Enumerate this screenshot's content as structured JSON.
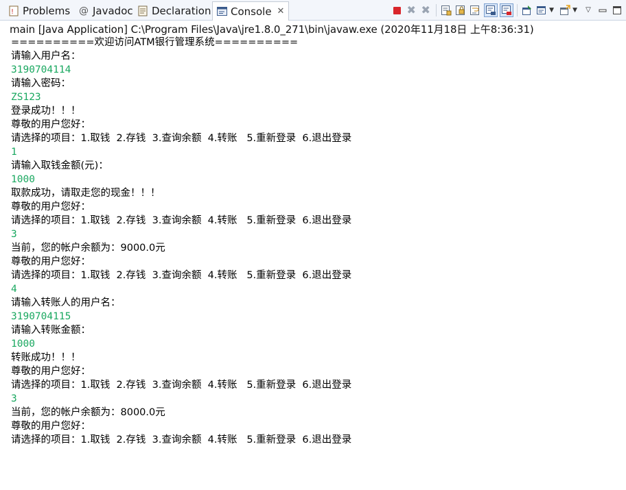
{
  "tabs": [
    {
      "label": "Problems",
      "icon": "problems-icon",
      "active": false
    },
    {
      "label": "Javadoc",
      "icon": "javadoc-icon",
      "active": false
    },
    {
      "label": "Declaration",
      "icon": "declaration-icon",
      "active": false
    },
    {
      "label": "Console",
      "icon": "console-icon",
      "active": true
    }
  ],
  "toolbar_icons": [
    "terminate-icon",
    "remove-launch-icon",
    "remove-all-terminated-icon",
    "clear-console-icon",
    "scroll-lock-icon",
    "word-wrap-icon",
    "show-console-on-stdout-icon",
    "show-console-on-stderr-icon",
    "pin-console-icon",
    "display-selected-console-icon",
    "open-console-icon",
    "view-menu-icon",
    "minimize-icon",
    "maximize-icon"
  ],
  "header": "main [Java Application] C:\\Program Files\\Java\\jre1.8.0_271\\bin\\javaw.exe (2020年11月18日 上午8:36:31)",
  "console_lines": [
    {
      "text": "==========欢迎访问ATM银行管理系统==========",
      "type": "out"
    },
    {
      "text": "请输入用户名：",
      "type": "out"
    },
    {
      "text": "3190704114",
      "type": "in"
    },
    {
      "text": "请输入密码：",
      "type": "out"
    },
    {
      "text": "ZS123",
      "type": "in"
    },
    {
      "text": "登录成功！！！",
      "type": "out"
    },
    {
      "text": "尊敬的用户您好：",
      "type": "out"
    },
    {
      "text": "请选择的项目：1.取钱  2.存钱  3.查询余额  4.转账   5.重新登录  6.退出登录",
      "type": "out"
    },
    {
      "text": "1",
      "type": "in"
    },
    {
      "text": "请输入取钱金额(元)：",
      "type": "out"
    },
    {
      "text": "1000",
      "type": "in"
    },
    {
      "text": "取款成功，请取走您的现金！！！",
      "type": "out"
    },
    {
      "text": "尊敬的用户您好：",
      "type": "out"
    },
    {
      "text": "请选择的项目：1.取钱  2.存钱  3.查询余额  4.转账   5.重新登录  6.退出登录",
      "type": "out"
    },
    {
      "text": "3",
      "type": "in"
    },
    {
      "text": "当前，您的帐户余额为：9000.0元",
      "type": "out"
    },
    {
      "text": "尊敬的用户您好：",
      "type": "out"
    },
    {
      "text": "请选择的项目：1.取钱  2.存钱  3.查询余额  4.转账   5.重新登录  6.退出登录",
      "type": "out"
    },
    {
      "text": "4",
      "type": "in"
    },
    {
      "text": "请输入转账人的用户名：",
      "type": "out"
    },
    {
      "text": "3190704115",
      "type": "in"
    },
    {
      "text": "请输入转账金额：",
      "type": "out"
    },
    {
      "text": "1000",
      "type": "in"
    },
    {
      "text": "转账成功！！！",
      "type": "out"
    },
    {
      "text": "尊敬的用户您好：",
      "type": "out"
    },
    {
      "text": "请选择的项目：1.取钱  2.存钱  3.查询余额  4.转账   5.重新登录  6.退出登录",
      "type": "out"
    },
    {
      "text": "3",
      "type": "in"
    },
    {
      "text": "当前，您的帐户余额为：8000.0元",
      "type": "out"
    },
    {
      "text": "尊敬的用户您好：",
      "type": "out"
    },
    {
      "text": "请选择的项目：1.取钱  2.存钱  3.查询余额  4.转账   5.重新登录  6.退出登录",
      "type": "out"
    }
  ],
  "colors": {
    "input_text": "#1aa860",
    "output_text": "#000000",
    "tabbar_bg": "#f3f6fb",
    "terminate_red": "#d9262b"
  }
}
